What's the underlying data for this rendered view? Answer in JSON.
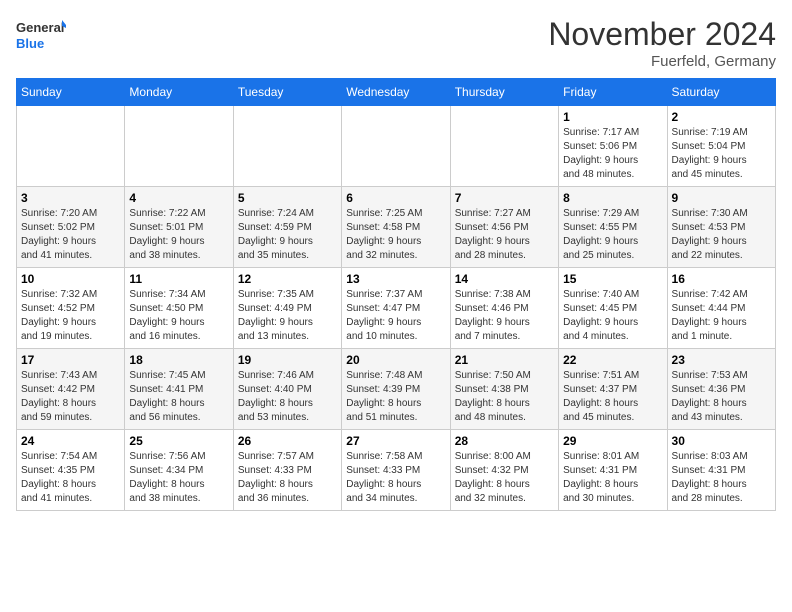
{
  "logo": {
    "line1": "General",
    "line2": "Blue"
  },
  "title": "November 2024",
  "location": "Fuerfeld, Germany",
  "weekdays": [
    "Sunday",
    "Monday",
    "Tuesday",
    "Wednesday",
    "Thursday",
    "Friday",
    "Saturday"
  ],
  "weeks": [
    [
      {
        "day": "",
        "info": ""
      },
      {
        "day": "",
        "info": ""
      },
      {
        "day": "",
        "info": ""
      },
      {
        "day": "",
        "info": ""
      },
      {
        "day": "",
        "info": ""
      },
      {
        "day": "1",
        "info": "Sunrise: 7:17 AM\nSunset: 5:06 PM\nDaylight: 9 hours\nand 48 minutes."
      },
      {
        "day": "2",
        "info": "Sunrise: 7:19 AM\nSunset: 5:04 PM\nDaylight: 9 hours\nand 45 minutes."
      }
    ],
    [
      {
        "day": "3",
        "info": "Sunrise: 7:20 AM\nSunset: 5:02 PM\nDaylight: 9 hours\nand 41 minutes."
      },
      {
        "day": "4",
        "info": "Sunrise: 7:22 AM\nSunset: 5:01 PM\nDaylight: 9 hours\nand 38 minutes."
      },
      {
        "day": "5",
        "info": "Sunrise: 7:24 AM\nSunset: 4:59 PM\nDaylight: 9 hours\nand 35 minutes."
      },
      {
        "day": "6",
        "info": "Sunrise: 7:25 AM\nSunset: 4:58 PM\nDaylight: 9 hours\nand 32 minutes."
      },
      {
        "day": "7",
        "info": "Sunrise: 7:27 AM\nSunset: 4:56 PM\nDaylight: 9 hours\nand 28 minutes."
      },
      {
        "day": "8",
        "info": "Sunrise: 7:29 AM\nSunset: 4:55 PM\nDaylight: 9 hours\nand 25 minutes."
      },
      {
        "day": "9",
        "info": "Sunrise: 7:30 AM\nSunset: 4:53 PM\nDaylight: 9 hours\nand 22 minutes."
      }
    ],
    [
      {
        "day": "10",
        "info": "Sunrise: 7:32 AM\nSunset: 4:52 PM\nDaylight: 9 hours\nand 19 minutes."
      },
      {
        "day": "11",
        "info": "Sunrise: 7:34 AM\nSunset: 4:50 PM\nDaylight: 9 hours\nand 16 minutes."
      },
      {
        "day": "12",
        "info": "Sunrise: 7:35 AM\nSunset: 4:49 PM\nDaylight: 9 hours\nand 13 minutes."
      },
      {
        "day": "13",
        "info": "Sunrise: 7:37 AM\nSunset: 4:47 PM\nDaylight: 9 hours\nand 10 minutes."
      },
      {
        "day": "14",
        "info": "Sunrise: 7:38 AM\nSunset: 4:46 PM\nDaylight: 9 hours\nand 7 minutes."
      },
      {
        "day": "15",
        "info": "Sunrise: 7:40 AM\nSunset: 4:45 PM\nDaylight: 9 hours\nand 4 minutes."
      },
      {
        "day": "16",
        "info": "Sunrise: 7:42 AM\nSunset: 4:44 PM\nDaylight: 9 hours\nand 1 minute."
      }
    ],
    [
      {
        "day": "17",
        "info": "Sunrise: 7:43 AM\nSunset: 4:42 PM\nDaylight: 8 hours\nand 59 minutes."
      },
      {
        "day": "18",
        "info": "Sunrise: 7:45 AM\nSunset: 4:41 PM\nDaylight: 8 hours\nand 56 minutes."
      },
      {
        "day": "19",
        "info": "Sunrise: 7:46 AM\nSunset: 4:40 PM\nDaylight: 8 hours\nand 53 minutes."
      },
      {
        "day": "20",
        "info": "Sunrise: 7:48 AM\nSunset: 4:39 PM\nDaylight: 8 hours\nand 51 minutes."
      },
      {
        "day": "21",
        "info": "Sunrise: 7:50 AM\nSunset: 4:38 PM\nDaylight: 8 hours\nand 48 minutes."
      },
      {
        "day": "22",
        "info": "Sunrise: 7:51 AM\nSunset: 4:37 PM\nDaylight: 8 hours\nand 45 minutes."
      },
      {
        "day": "23",
        "info": "Sunrise: 7:53 AM\nSunset: 4:36 PM\nDaylight: 8 hours\nand 43 minutes."
      }
    ],
    [
      {
        "day": "24",
        "info": "Sunrise: 7:54 AM\nSunset: 4:35 PM\nDaylight: 8 hours\nand 41 minutes."
      },
      {
        "day": "25",
        "info": "Sunrise: 7:56 AM\nSunset: 4:34 PM\nDaylight: 8 hours\nand 38 minutes."
      },
      {
        "day": "26",
        "info": "Sunrise: 7:57 AM\nSunset: 4:33 PM\nDaylight: 8 hours\nand 36 minutes."
      },
      {
        "day": "27",
        "info": "Sunrise: 7:58 AM\nSunset: 4:33 PM\nDaylight: 8 hours\nand 34 minutes."
      },
      {
        "day": "28",
        "info": "Sunrise: 8:00 AM\nSunset: 4:32 PM\nDaylight: 8 hours\nand 32 minutes."
      },
      {
        "day": "29",
        "info": "Sunrise: 8:01 AM\nSunset: 4:31 PM\nDaylight: 8 hours\nand 30 minutes."
      },
      {
        "day": "30",
        "info": "Sunrise: 8:03 AM\nSunset: 4:31 PM\nDaylight: 8 hours\nand 28 minutes."
      }
    ]
  ]
}
